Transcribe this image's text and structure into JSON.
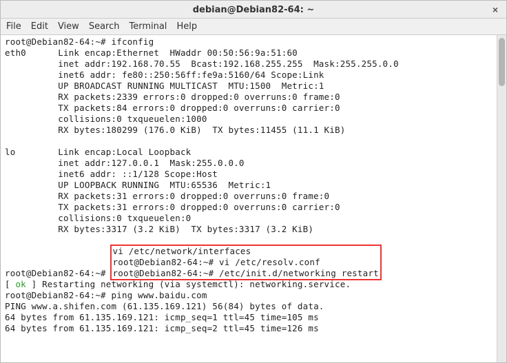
{
  "window": {
    "title": "debian@Debian82-64: ~"
  },
  "menu": {
    "file": "File",
    "edit": "Edit",
    "view": "View",
    "search": "Search",
    "terminal": "Terminal",
    "help": "Help"
  },
  "term": {
    "l01": "root@Debian82-64:~# ifconfig",
    "l02": "eth0      Link encap:Ethernet  HWaddr 00:50:56:9a:51:60",
    "l03": "          inet addr:192.168.70.55  Bcast:192.168.255.255  Mask:255.255.0.0",
    "l04": "          inet6 addr: fe80::250:56ff:fe9a:5160/64 Scope:Link",
    "l05": "          UP BROADCAST RUNNING MULTICAST  MTU:1500  Metric:1",
    "l06": "          RX packets:2339 errors:0 dropped:0 overruns:0 frame:0",
    "l07": "          TX packets:84 errors:0 dropped:0 overruns:0 carrier:0",
    "l08": "          collisions:0 txqueuelen:1000",
    "l09": "          RX bytes:180299 (176.0 KiB)  TX bytes:11455 (11.1 KiB)",
    "l10": "",
    "l11": "lo        Link encap:Local Loopback",
    "l12": "          inet addr:127.0.0.1  Mask:255.0.0.0",
    "l13": "          inet6 addr: ::1/128 Scope:Host",
    "l14": "          UP LOOPBACK RUNNING  MTU:65536  Metric:1",
    "l15": "          RX packets:31 errors:0 dropped:0 overruns:0 frame:0",
    "l16": "          TX packets:31 errors:0 dropped:0 overruns:0 carrier:0",
    "l17": "          collisions:0 txqueuelen:0",
    "l18": "          RX bytes:3317 (3.2 KiB)  TX bytes:3317 (3.2 KiB)",
    "l19": "",
    "l20a": "root@Debian82-64:~# ",
    "l20b": "vi /etc/network/interfaces",
    "l21a": "root@Debian82-64:~# ",
    "l21b": "vi /etc/resolv.conf",
    "l22a": "root@Debian82-64:~# ",
    "l22b": "/etc/init.d/networking restart",
    "l23a": "[ ",
    "l23ok": "ok",
    "l23b": " ] Restarting networking (via systemctl): networking.service.",
    "l24": "root@Debian82-64:~# ping www.baidu.com",
    "l25": "PING www.a.shifen.com (61.135.169.121) 56(84) bytes of data.",
    "l26": "64 bytes from 61.135.169.121: icmp_seq=1 ttl=45 time=105 ms",
    "l27": "64 bytes from 61.135.169.121: icmp_seq=2 ttl=45 time=126 ms"
  }
}
